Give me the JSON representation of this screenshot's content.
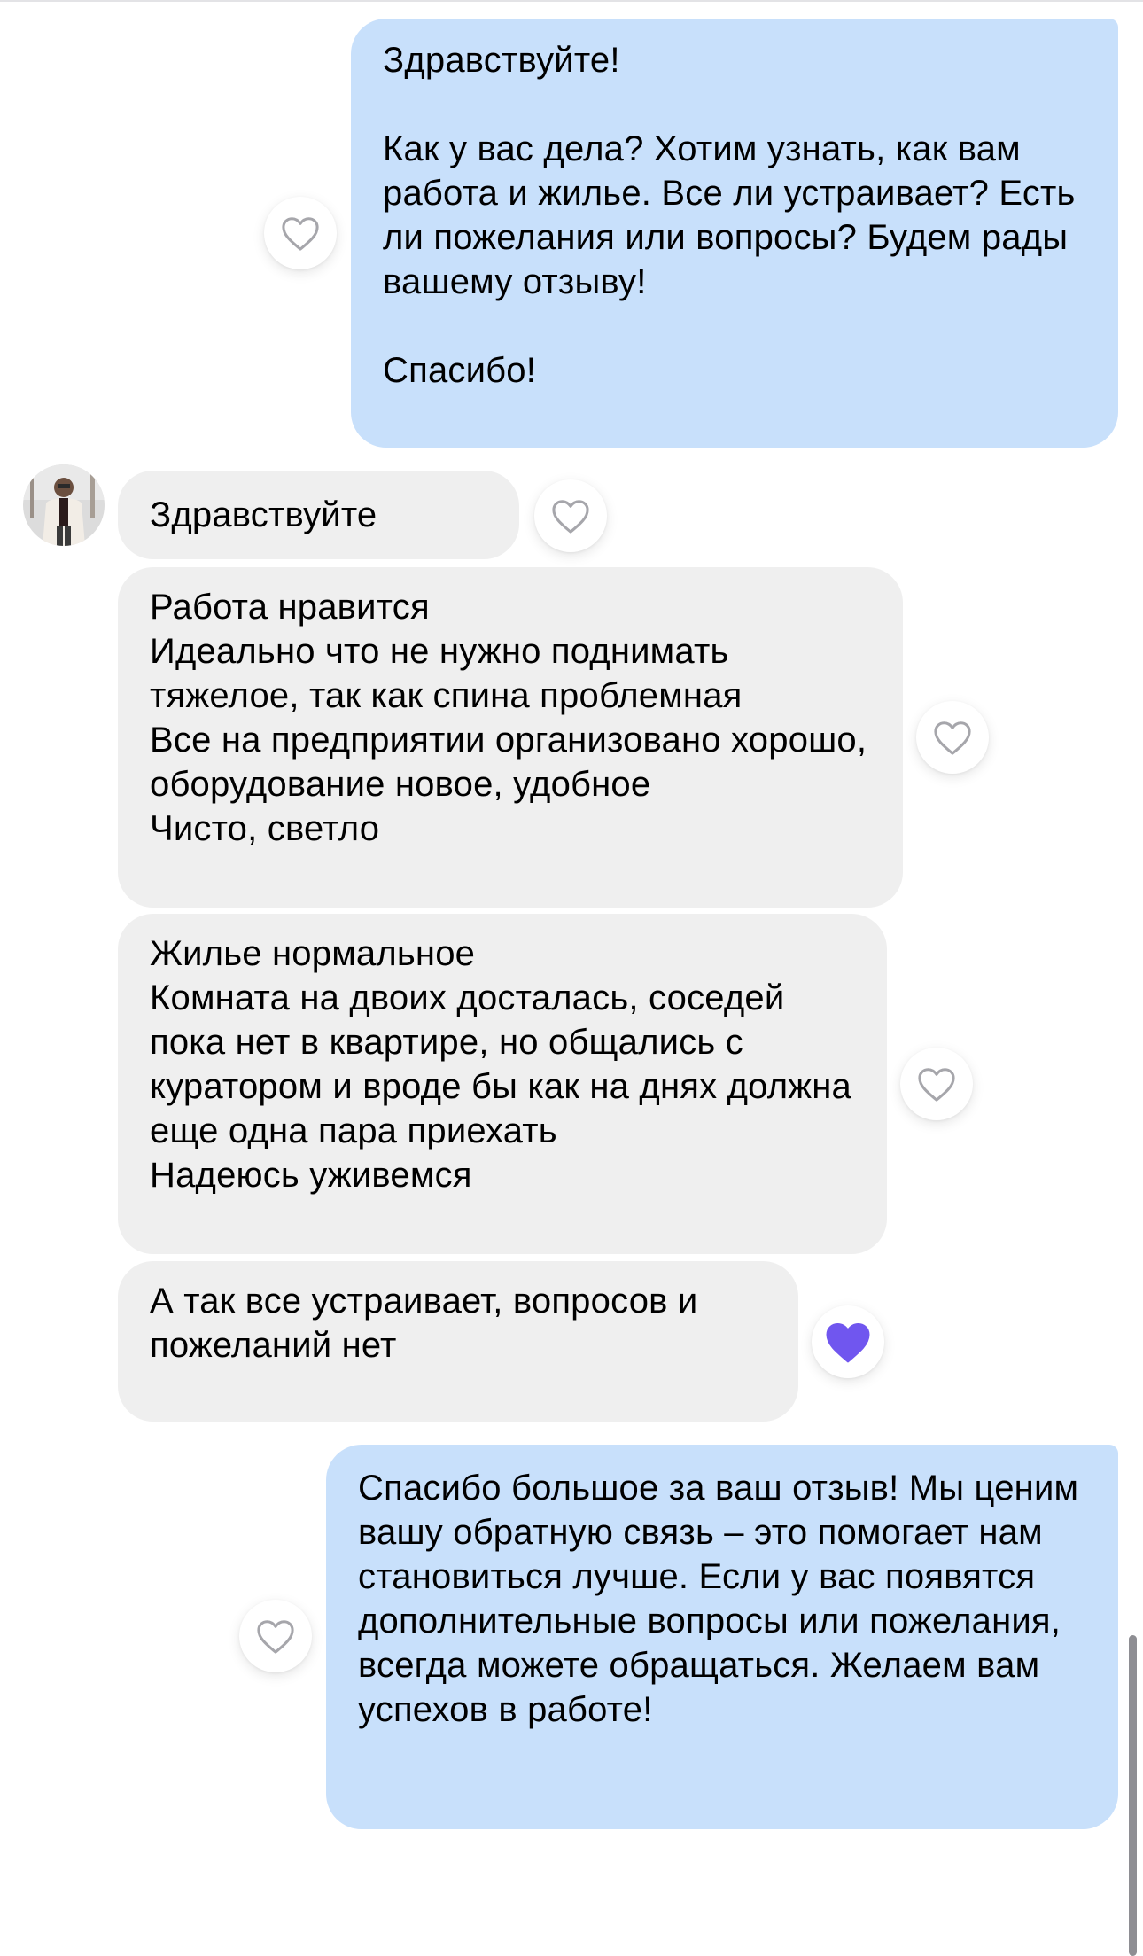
{
  "messages": [
    {
      "id": "m1",
      "direction": "outgoing",
      "text": "Здравствуйте!\n\nКак у вас дела? Хотим узнать, как вам работа и жилье. Все ли устраивает? Есть ли пожелания или вопросы? Будем рады вашему отзыву!\n\nСпасибо!",
      "liked": false
    },
    {
      "id": "m2",
      "direction": "incoming",
      "text": "Здравствуйте",
      "liked": false
    },
    {
      "id": "m3",
      "direction": "incoming",
      "text": "Работа нравится\nИдеально что не нужно поднимать тяжелое, так как спина проблемная\nВсе на предприятии организовано хорошо, оборудование новое, удобное\nЧисто, светло",
      "liked": false
    },
    {
      "id": "m4",
      "direction": "incoming",
      "text": "Жилье нормальное\nКомната на двоих досталась, соседей пока нет в квартире, но общались с куратором и вроде бы как на днях должна еще одна пара приехать\nНадеюсь уживемся",
      "liked": false
    },
    {
      "id": "m5",
      "direction": "incoming",
      "text": "А так все устраивает, вопросов и пожеланий нет",
      "liked": true
    },
    {
      "id": "m6",
      "direction": "outgoing",
      "text": "Спасибо большое за ваш отзыв! Мы ценим вашу обратную связь – это помогает нам становиться лучше. Если у вас появятся дополнительные вопросы или пожелания, всегда можете обращаться. Желаем вам успехов в работе!",
      "liked": false
    }
  ],
  "icons": {
    "like": "heart-outline-icon",
    "liked": "heart-filled-icon",
    "avatar": "user-avatar"
  },
  "colors": {
    "outgoing_bubble": "#c8e0fb",
    "incoming_bubble": "#efefef",
    "heart_outline": "#a6a6ab",
    "heart_filled": "#7056ef"
  }
}
